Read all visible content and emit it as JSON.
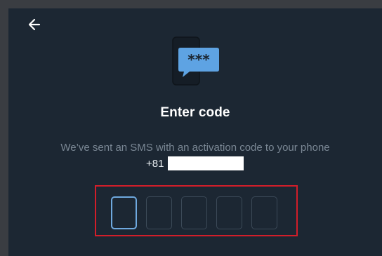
{
  "back_icon": "arrow-left-icon",
  "illustration_icon": "sms-code-icon",
  "illustration_text": "***",
  "title": "Enter code",
  "subtitle": "We’ve sent an SMS with an activation code to your phone",
  "phone": {
    "prefix": "+81"
  },
  "code": {
    "boxes": [
      "",
      "",
      "",
      "",
      ""
    ],
    "active_index": 0
  },
  "colors": {
    "background": "#1c2733",
    "accent": "#5ea3e3",
    "highlight": "#d21e2a"
  }
}
